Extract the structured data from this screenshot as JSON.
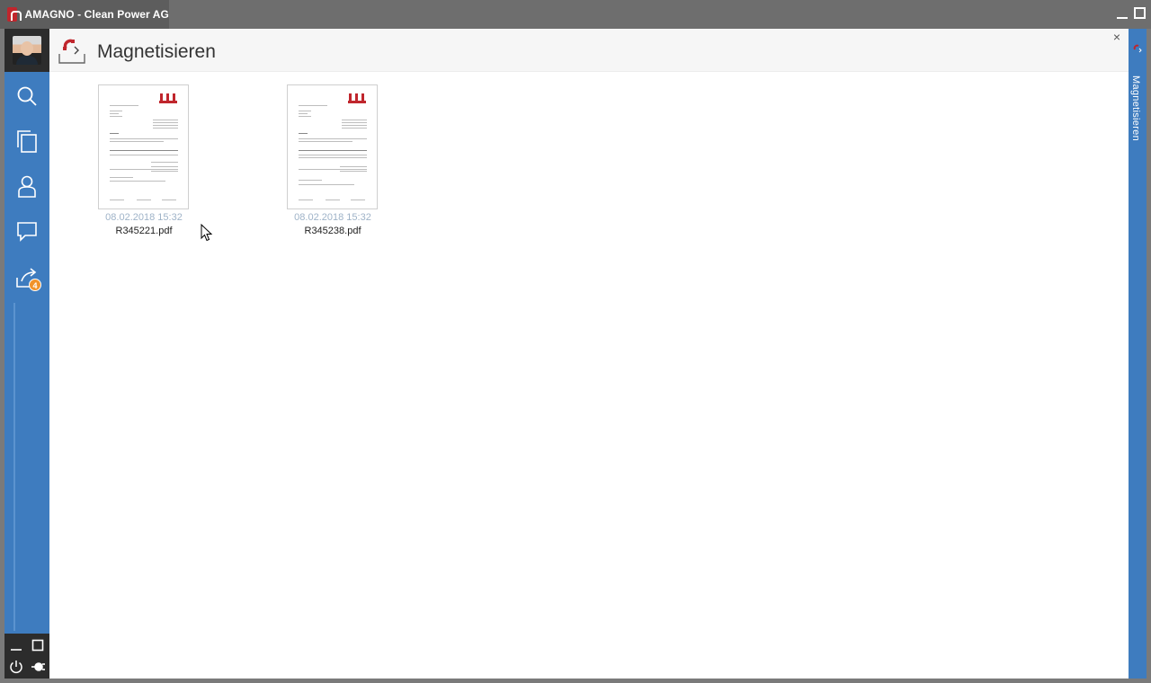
{
  "window": {
    "title": "AMAGNO - Clean Power AG"
  },
  "sidebar": {
    "items": [
      {
        "name": "search",
        "icon": "search-icon"
      },
      {
        "name": "documents",
        "icon": "documents-icon"
      },
      {
        "name": "contacts",
        "icon": "user-icon"
      },
      {
        "name": "comments",
        "icon": "chat-icon"
      },
      {
        "name": "tasks",
        "icon": "inbox-arrow-icon",
        "badge": "4"
      }
    ],
    "accent": "#3e7cbf"
  },
  "header": {
    "title": "Magnetisieren",
    "close_label": "×"
  },
  "documents": [
    {
      "date": "08.02.2018 15:32",
      "name": "R345221.pdf"
    },
    {
      "date": "08.02.2018 15:32",
      "name": "R345238.pdf"
    }
  ],
  "right_panel": {
    "label": "Magnetisieren"
  }
}
